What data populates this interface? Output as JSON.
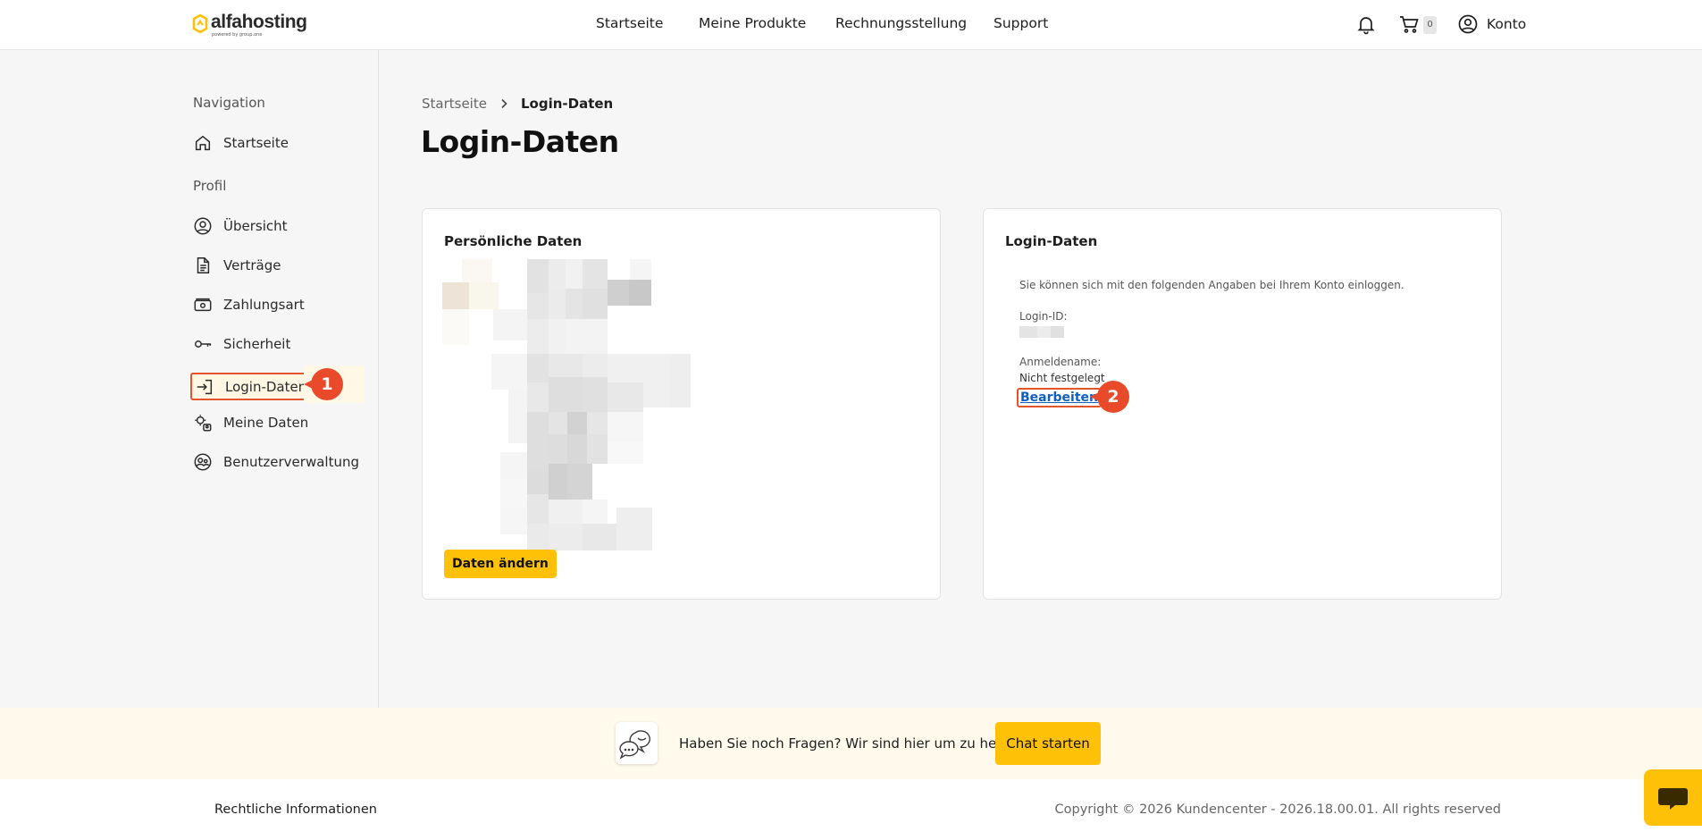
{
  "header": {
    "logo_text": "alfahosting",
    "logo_sub": "powered by group.one",
    "nav": [
      "Startseite",
      "Meine Produkte",
      "Rechnungsstellung",
      "Support"
    ],
    "cart_count": "0",
    "account_label": "Konto"
  },
  "sidebar": {
    "heading_navigation": "Navigation",
    "heading_profile": "Profil",
    "items": [
      {
        "label": "Startseite",
        "icon": "home-icon"
      },
      {
        "label": "Übersicht",
        "icon": "user-circle-icon"
      },
      {
        "label": "Verträge",
        "icon": "document-icon"
      },
      {
        "label": "Zahlungsart",
        "icon": "payment-icon"
      },
      {
        "label": "Sicherheit",
        "icon": "key-icon"
      },
      {
        "label": "Login-Daten",
        "icon": "login-icon"
      },
      {
        "label": "Meine Daten",
        "icon": "user-settings-icon"
      },
      {
        "label": "Benutzerverwaltung",
        "icon": "users-icon"
      }
    ],
    "active_item": "Login-Daten"
  },
  "callouts": [
    "1",
    "2"
  ],
  "breadcrumb": {
    "root": "Startseite",
    "current": "Login-Daten"
  },
  "page_title": "Login-Daten",
  "personal_card": {
    "title": "Persönliche Daten",
    "button": "Daten ändern"
  },
  "login_card": {
    "title": "Login-Daten",
    "intro": "Sie können sich mit den folgenden Angaben bei Ihrem Konto einloggen.",
    "login_id_label": "Login-ID:",
    "username_label": "Anmeldename:",
    "username_value": "Nicht festgelegt",
    "edit_link": "Bearbeiten"
  },
  "chat_banner": {
    "text": "Haben Sie noch Fragen? Wir sind hier um zu helfen.",
    "button": "Chat starten"
  },
  "footer": {
    "legal": "Rechtliche Informationen",
    "copyright": "Copyright © 2026 Kundencenter - 2026.18.00.01. All rights reserved"
  },
  "colors": {
    "accent": "#ffc107",
    "highlight": "#e4552b",
    "link": "#1060c0"
  }
}
